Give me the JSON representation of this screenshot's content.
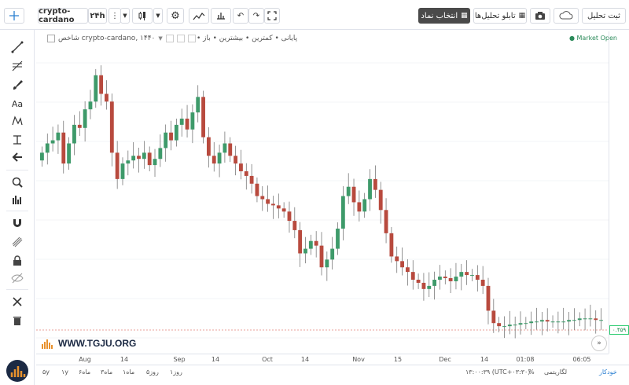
{
  "toolbar": {
    "symbol": "crypto-cardano",
    "interval": "۲۴h",
    "select_symbol": "انتخاب نماد",
    "analysis_board": "تابلو تحلیل‌ها",
    "save_analysis": "ثبت تحلیل"
  },
  "legend": {
    "series_title": "شاخص crypto-cardano, ۱۴۴۰",
    "ohlc_labels": "• پایانی • کمترین • بیشترین • باز",
    "market_status": "Market Open"
  },
  "price": {
    "current_label": "۰.۴۵۹"
  },
  "brand": {
    "text": "WWW.TGJU.ORG"
  },
  "time_axis": [
    {
      "label": "Aug"
    },
    {
      "label": "14"
    },
    {
      "label": "Sep"
    },
    {
      "label": "14"
    },
    {
      "label": "Oct"
    },
    {
      "label": "14"
    },
    {
      "label": "Nov"
    },
    {
      "label": "15"
    },
    {
      "label": "Dec"
    },
    {
      "label": "14"
    },
    {
      "label": "01:08"
    },
    {
      "label": "06:05"
    }
  ],
  "bottombar": {
    "ranges": [
      "۵y",
      "۱y",
      "۶ماه",
      "۳ماه",
      "۱ماه",
      "۵روز",
      "۱روز"
    ],
    "clock": "۱۳:۰۰:۳۹ (UTC+۰۳:۳۰)",
    "percent": "%",
    "log": "لگاریتمی",
    "auto": "خودکار"
  },
  "colors": {
    "up": "#3e9a6a",
    "down": "#b84a3e",
    "accent": "#2ecc71"
  },
  "chart_data": {
    "type": "candlestick",
    "title": "شاخص crypto-cardano, ۱۴۴۰",
    "x_ticks": [
      "Aug",
      "14",
      "Sep",
      "14",
      "Oct",
      "14",
      "Nov",
      "15",
      "Dec",
      "14",
      "01:08",
      "06:05"
    ],
    "last_price": "۰.۴۵۹",
    "closes": [
      2.12,
      2.18,
      2.2,
      2.25,
      2.05,
      2.18,
      2.3,
      2.28,
      2.4,
      2.45,
      2.62,
      2.5,
      2.45,
      2.12,
      1.95,
      2.05,
      2.07,
      2.1,
      2.08,
      2.12,
      2.04,
      2.08,
      2.15,
      2.25,
      2.2,
      2.3,
      2.34,
      2.27,
      2.38,
      2.48,
      2.22,
      2.1,
      2.05,
      2.12,
      2.18,
      2.1,
      2.05,
      2.0,
      1.97,
      1.92,
      1.84,
      1.82,
      1.79,
      1.78,
      1.76,
      1.74,
      1.68,
      1.62,
      1.47,
      1.5,
      1.55,
      1.52,
      1.38,
      1.43,
      1.5,
      1.63,
      1.84,
      1.9,
      1.8,
      1.74,
      1.82,
      1.95,
      1.88,
      1.75,
      1.6,
      1.45,
      1.42,
      1.38,
      1.35,
      1.3,
      1.28,
      1.24,
      1.26,
      1.3,
      1.32,
      1.31,
      1.29,
      1.32,
      1.35,
      1.33,
      1.33,
      1.3,
      1.26,
      1.1,
      1.02,
      1.0,
      1.0,
      1.01,
      1.01,
      1.02,
      1.02,
      1.03,
      1.03,
      1.04,
      1.03,
      1.03,
      1.03,
      1.03,
      1.04,
      1.04,
      1.05,
      1.05,
      1.05,
      1.04,
      1.04
    ]
  }
}
